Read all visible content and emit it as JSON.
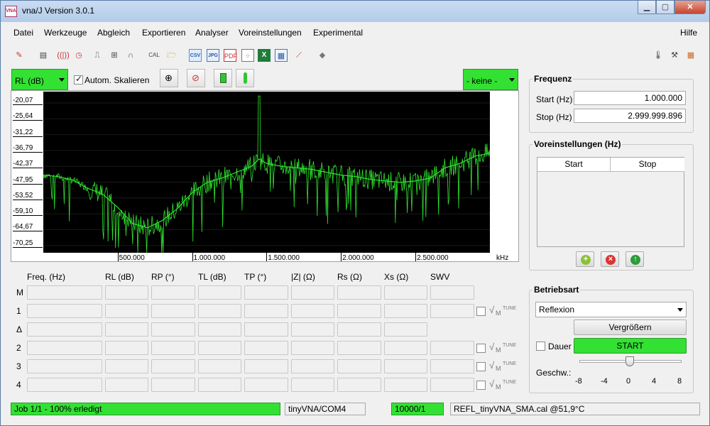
{
  "window": {
    "title": "vna/J Version 3.0.1",
    "app_icon_text": "VNA"
  },
  "window_buttons": {
    "minimize": "▁",
    "maximize": "▢",
    "close": "✕"
  },
  "menu": {
    "items": [
      "Datei",
      "Werkzeuge",
      "Abgleich",
      "Exportieren",
      "Analyser",
      "Voreinstellungen",
      "Experimental"
    ],
    "help": "Hilfe"
  },
  "toolbar": {
    "cal_label": "CAL",
    "csv_label": "CSV",
    "jpg_label": "JPG",
    "pdf_label": "PDF",
    "xls_label": "X",
    "icons": [
      "ruler-icon",
      "calibrate-icon",
      "antenna-icon",
      "clock-icon",
      "cable-icon",
      "lm-icon",
      "magnet-icon",
      "cal-icon",
      "open-folder-icon",
      "csv-icon",
      "jpg-icon",
      "pdf-icon",
      "scatter-icon",
      "excel-icon",
      "xml-icon",
      "graph-icon",
      "eraser-icon",
      "thermometer-icon",
      "tools-icon",
      "grid-icon"
    ]
  },
  "chart_toolbar": {
    "scale_select": "RL (dB)",
    "auto_scale_label": "Autom. Skalieren",
    "auto_scale_checked": true,
    "reference_select": "- keine -"
  },
  "chart_data": {
    "type": "line",
    "ylabel": "RL (dB)",
    "xlabel": "kHz",
    "y_ticks": [
      "-20,07",
      "-25,64",
      "-31,22",
      "-36,79",
      "-42,37",
      "-47,95",
      "-53,52",
      "-59,10",
      "-64,67",
      "-70,25"
    ],
    "x_ticks": [
      "500.000",
      "1.000.000",
      "1.500.000",
      "2.000.000",
      "2.500.000"
    ],
    "xlim_khz": [
      1000,
      2999999.896
    ],
    "ylim": [
      -73.0,
      -18.0
    ],
    "background": "#000000",
    "trace_color": "#2ee62e",
    "series": [
      {
        "x_khz": [
          1000,
          100000,
          200000,
          300000,
          400000,
          500000,
          600000,
          700000,
          800000,
          900000,
          1000000,
          1100000,
          1200000,
          1300000,
          1400000,
          1450000,
          1500000,
          1600000,
          1700000,
          1800000,
          1900000,
          2000000,
          2100000,
          2200000,
          2300000,
          2400000,
          2500000,
          2600000,
          2700000,
          2800000,
          2900000,
          3000000
        ],
        "values": [
          -46.5,
          -47.0,
          -48.2,
          -51.0,
          -53.0,
          -57.5,
          -63.0,
          -64.5,
          -62.0,
          -58.0,
          -52.5,
          -49.0,
          -47.5,
          -45.5,
          -43.5,
          -41.0,
          -42.5,
          -43.5,
          -44.0,
          -44.5,
          -45.5,
          -46.5,
          -47.0,
          -48.0,
          -48.5,
          -49.0,
          -48.5,
          -47.5,
          -44.0,
          -42.5,
          -40.0,
          -39.0
        ]
      }
    ]
  },
  "markers": {
    "headers": [
      "Freq. (Hz)",
      "RL (dB)",
      "RP (°)",
      "TL (dB)",
      "TP (°)",
      "|Z| (Ω)",
      "Rs (Ω)",
      "Xs (Ω)",
      "SWV"
    ],
    "rows": [
      "M",
      "1",
      "Δ",
      "2",
      "3",
      "4"
    ],
    "tune_labels": {
      "sqrt": "√",
      "m": "M",
      "tune": "TUNE"
    }
  },
  "frequency": {
    "title": "Frequenz",
    "start_label": "Start (Hz)",
    "start_value": "1.000.000",
    "stop_label": "Stop (Hz)",
    "stop_value": "2.999.999.896"
  },
  "presets": {
    "title": "Voreinstellungen (Hz)",
    "col_start": "Start",
    "col_stop": "Stop"
  },
  "mode": {
    "title": "Betriebsart",
    "mode_value": "Reflexion",
    "zoom_button": "Vergrößern",
    "continuous_label": "Dauer",
    "start_button": "START",
    "speed_label": "Geschw.:",
    "speed_ticks": [
      "-8",
      "-4",
      "0",
      "4",
      "8"
    ],
    "speed_value": 0
  },
  "status": {
    "job": "Job 1/1 - 100% erledigt",
    "device": "tinyVNA/COM4",
    "samples": "10000/1",
    "calibration": "REFL_tinyVNA_SMA.cal @51,9°C"
  },
  "colors": {
    "accent_green": "#33e133",
    "plot_bg": "#000000",
    "trace": "#2ee62e"
  }
}
